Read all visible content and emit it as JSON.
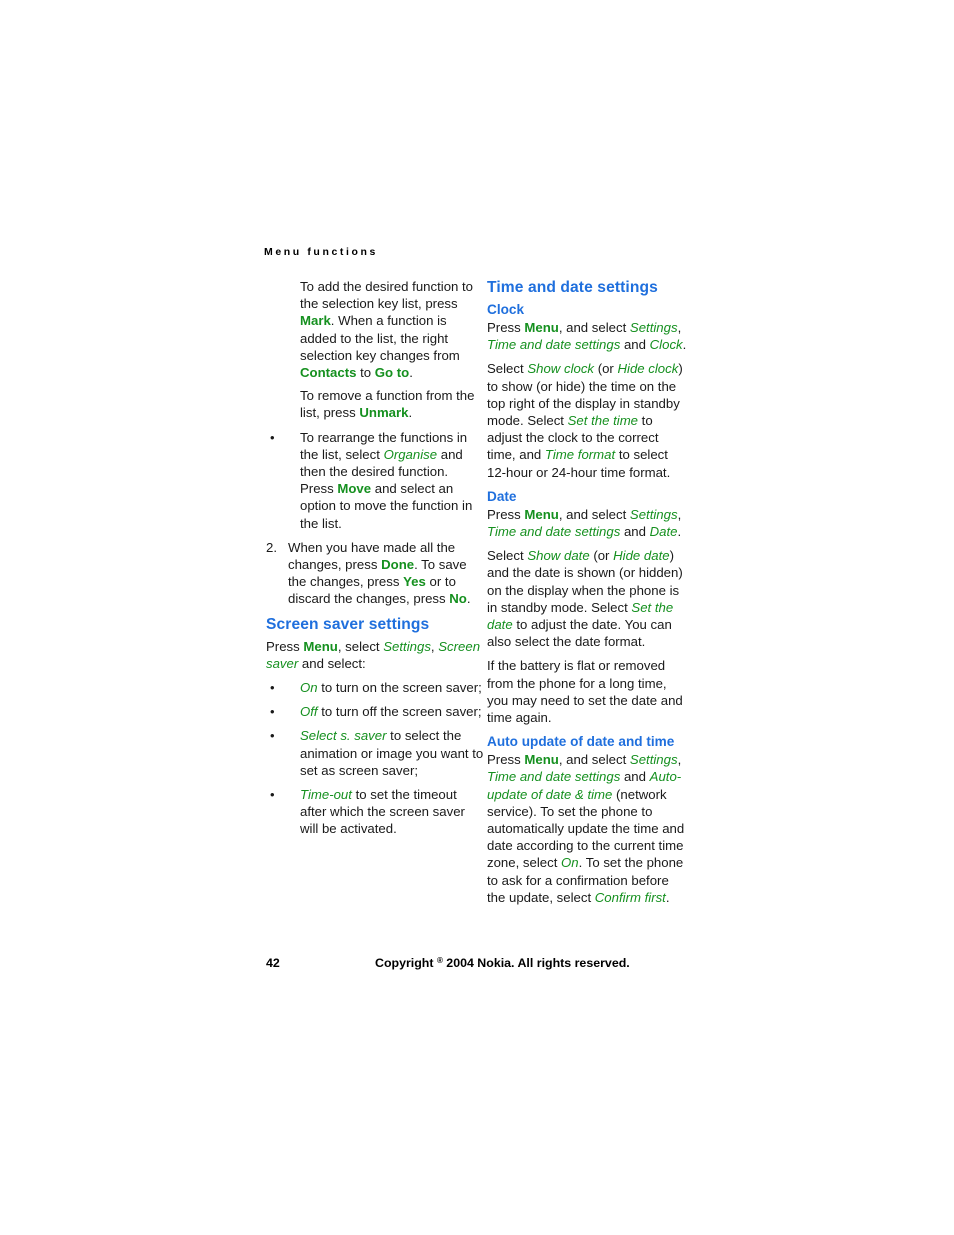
{
  "page": {
    "running_head": "Menu functions",
    "page_number": "42",
    "copyright_pre": "Copyright ",
    "copyright_symbol": "®",
    "copyright_post": " 2004 Nokia. All rights reserved.",
    "accent_blue": "#1f6fdd",
    "accent_green": "#15901f",
    "background": "#ffffff",
    "text_color": "#1a1a1a"
  },
  "left_column": {
    "para_mark": {
      "t1": "To add the desired function to the selection key list, press ",
      "b1": "Mark",
      "t2": ". When a function is added to the list, the right selection key changes from ",
      "b2": "Contacts",
      "t3": " to ",
      "b3": "Go to",
      "t4": "."
    },
    "para_unmark": {
      "t1": "To remove a function from the list, press ",
      "b1": "Unmark",
      "t2": "."
    },
    "bullet_rearrange": {
      "dot": "•",
      "t1": "To rearrange the functions in the list, select ",
      "i1": "Organise",
      "t2": " and then the desired function. Press ",
      "b1": "Move",
      "t3": " and select an option to move the function in the list."
    },
    "item_two": {
      "dot": "2.",
      "t1": "When you have made all the changes, press ",
      "b1": "Done",
      "t2": ". To save the changes, press ",
      "b2": "Yes",
      "t3": " or to discard the changes, press ",
      "b3": "No",
      "t4": "."
    },
    "screen_saver": {
      "heading": "Screen saver settings",
      "intro": {
        "t1": "Press ",
        "b1": "Menu",
        "t2": ", select ",
        "i1": "Settings",
        "t3": ", ",
        "i2": "Screen saver",
        "t4": " and select:"
      },
      "bullets": [
        {
          "dot": "•",
          "i1": "On",
          "t1": " to turn on the screen saver;"
        },
        {
          "dot": "•",
          "i1": "Off",
          "t1": " to turn off the screen saver;"
        },
        {
          "dot": "•",
          "i1": "Select s. saver",
          "t1": " to select the animation or image you want to set as screen saver;"
        },
        {
          "dot": "•",
          "i1": "Time-out",
          "t1": " to set the timeout after which the screen saver will be activated."
        }
      ]
    }
  },
  "right_column": {
    "section_heading": "Time and date settings",
    "clock": {
      "heading": "Clock",
      "p1": {
        "t1": "Press ",
        "b1": "Menu",
        "t2": ", and select ",
        "i1": "Settings",
        "t3": ", ",
        "i2": "Time and date settings",
        "t4": " and ",
        "i3": "Clock",
        "t5": "."
      },
      "p2": {
        "t1": "Select ",
        "i1": "Show clock",
        "t2": " (or ",
        "i2": "Hide clock",
        "t3": ") to show (or hide) the time on the top right of the display in standby mode. Select ",
        "i3": "Set the time",
        "t4": " to adjust the clock to the correct time, and ",
        "i4": "Time format",
        "t5": " to select 12-hour or 24-hour time format."
      }
    },
    "date": {
      "heading": "Date",
      "p1": {
        "t1": "Press ",
        "b1": "Menu",
        "t2": ", and select ",
        "i1": "Settings",
        "t3": ", ",
        "i2": "Time and date settings",
        "t4": " and ",
        "i3": "Date",
        "t5": "."
      },
      "p2": {
        "t1": "Select ",
        "i1": "Show date",
        "t2": " (or ",
        "i2": "Hide date",
        "t3": ") and the date is shown (or hidden) on the display when the phone is in standby mode. Select ",
        "i3": "Set the date",
        "t4": " to adjust the date. You can also select the date format."
      },
      "p3": "If the battery is flat or removed from the phone for a long time, you may need to set the date and time again."
    },
    "auto_update": {
      "heading": "Auto update of date and time",
      "p1": {
        "t1": "Press ",
        "b1": "Menu",
        "t2": ", and select ",
        "i1": "Settings",
        "t3": ", ",
        "i2": "Time and date settings",
        "t4": " and ",
        "i3": "Auto-update of date & time",
        "t5": " (network service). To set the phone to automatically update the time and date according to the current time zone, select ",
        "i4": "On",
        "t6": ". To set the phone to ask for a confirmation before the update, select ",
        "i5": "Confirm first",
        "t7": "."
      }
    }
  }
}
